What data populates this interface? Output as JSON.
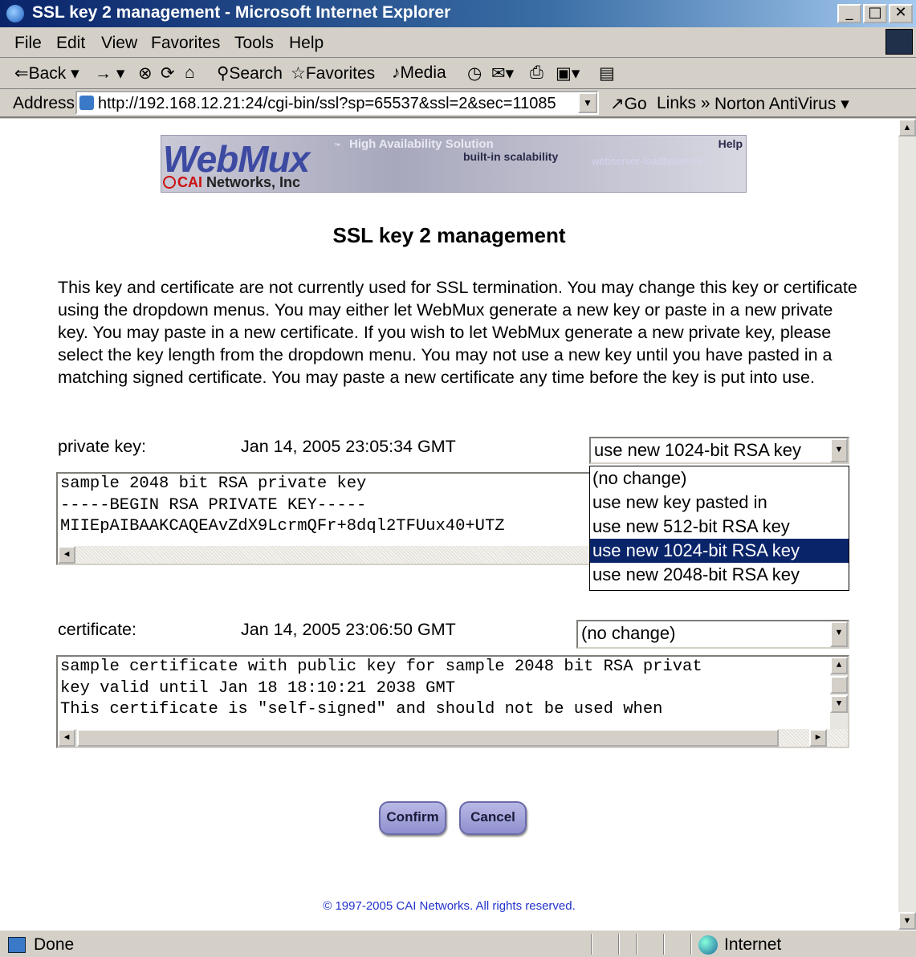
{
  "window": {
    "title": "SSL key 2 management - Microsoft Internet Explorer"
  },
  "menu": [
    "File",
    "Edit",
    "View",
    "Favorites",
    "Tools",
    "Help"
  ],
  "toolbar": {
    "back": "Back",
    "search": "Search",
    "favorites": "Favorites",
    "media": "Media"
  },
  "address": {
    "label": "Address",
    "url": "http://192.168.12.21:24/cgi-bin/ssl?sp=65537&ssl=2&sec=11085",
    "go": "Go",
    "links": "Links",
    "norton": "Norton AntiVirus"
  },
  "banner": {
    "logo": "WebMux",
    "tm": "™",
    "tagline1": "High Availability Solution",
    "tagline2": "built-in scalability",
    "tagline3": "webserver-loadbalancer",
    "help": "Help",
    "company_brand": "CAI",
    "company_rest": " Networks, Inc"
  },
  "page": {
    "title": "SSL key 2 management",
    "intro": "This key and certificate are not currently used for SSL termination. You may change this key or certificate using the dropdown menus. You may either let WebMux generate a new key or paste in a new private key. You may paste in a new certificate. If you wish to let WebMux generate a new private key, please select the key length from the dropdown menu. You may not use a new key until you have pasted in a matching signed certificate. You may paste a new certificate any time before the key is put into use."
  },
  "private_key": {
    "label": "private key:",
    "date": "Jan 14, 2005 23:05:34 GMT",
    "selected": "use new 1024-bit RSA key",
    "lines": [
      "sample 2048 bit RSA private key",
      "-----BEGIN RSA PRIVATE KEY-----",
      "MIIEpAIBAAKCAQEAvZdX9LcrmQFr+8dql2TFUux40+UTZ"
    ],
    "options": [
      {
        "label": "(no change)",
        "selected": false
      },
      {
        "label": "use new key pasted in",
        "selected": false
      },
      {
        "label": "use new 512-bit RSA key",
        "selected": false
      },
      {
        "label": "use new 1024-bit RSA key",
        "selected": true
      },
      {
        "label": "use new 2048-bit RSA key",
        "selected": false
      }
    ]
  },
  "certificate": {
    "label": "certificate:",
    "date": "Jan 14, 2005 23:06:50 GMT",
    "selected": "(no change)",
    "lines": [
      "sample certificate with public key for sample 2048 bit RSA privat",
      "key valid until Jan 18 18:10:21 2038 GMT",
      "This certificate is \"self-signed\" and should not be used when"
    ]
  },
  "buttons": {
    "confirm": "Confirm",
    "cancel": "Cancel"
  },
  "footer": "© 1997-2005 CAI Networks. All rights reserved.",
  "status": {
    "text": "Done",
    "zone": "Internet"
  }
}
